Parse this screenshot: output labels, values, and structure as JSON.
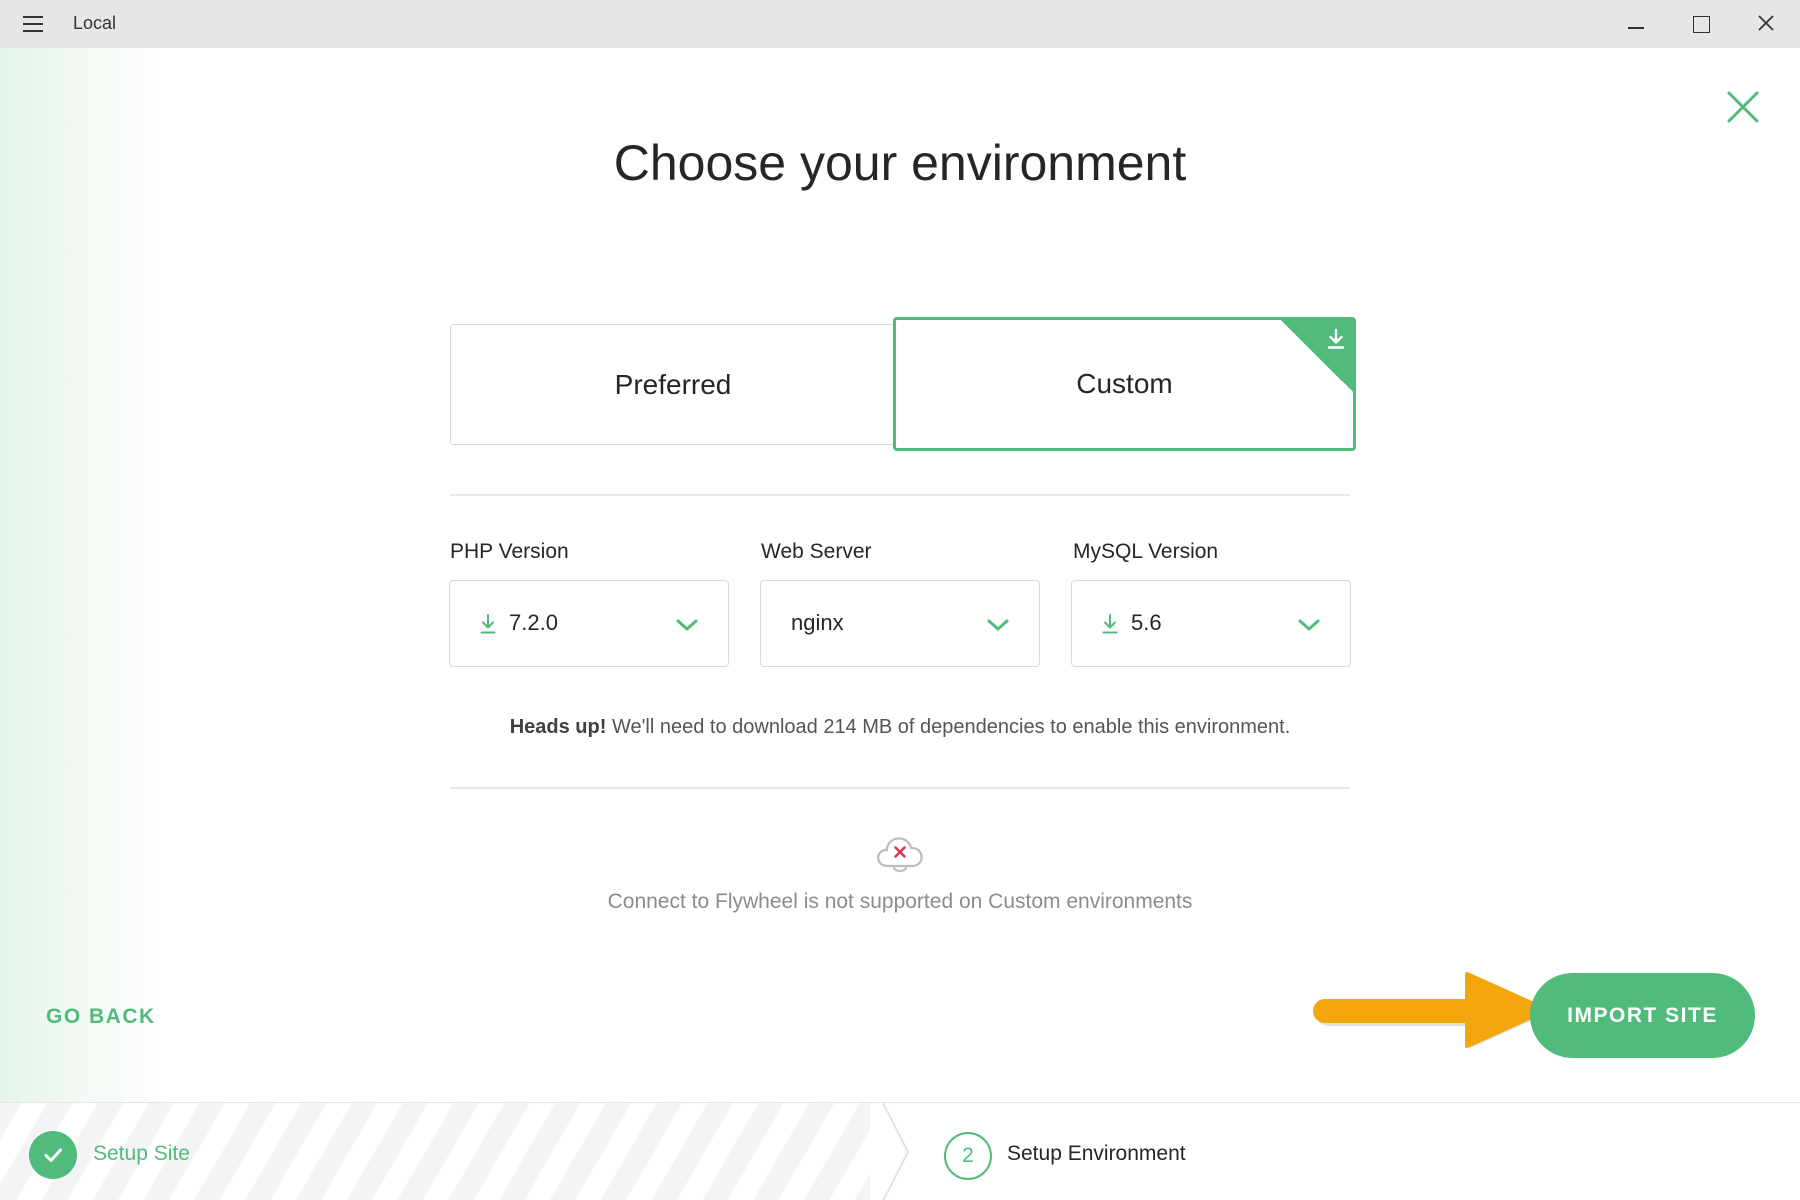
{
  "app": {
    "title": "Local"
  },
  "page": {
    "title": "Choose your environment"
  },
  "environments": {
    "preferred_label": "Preferred",
    "custom_label": "Custom",
    "selected": "Custom"
  },
  "fields": {
    "php": {
      "label": "PHP Version",
      "value": "7.2.0",
      "needs_download": true
    },
    "web_server": {
      "label": "Web Server",
      "value": "nginx",
      "needs_download": false
    },
    "mysql": {
      "label": "MySQL Version",
      "value": "5.6",
      "needs_download": true
    }
  },
  "notice": {
    "strong": "Heads up!",
    "text": " We'll need to download 214 MB of dependencies to enable this environment."
  },
  "flywheel": {
    "message": "Connect to Flywheel is not supported on Custom environments"
  },
  "actions": {
    "go_back": "GO BACK",
    "import": "IMPORT SITE"
  },
  "steps": [
    {
      "number": "1",
      "label": "Setup Site",
      "status": "complete"
    },
    {
      "number": "2",
      "label": "Setup Environment",
      "status": "current"
    }
  ],
  "colors": {
    "accent": "#51bb7b",
    "annotation_arrow": "#f5a50d"
  }
}
